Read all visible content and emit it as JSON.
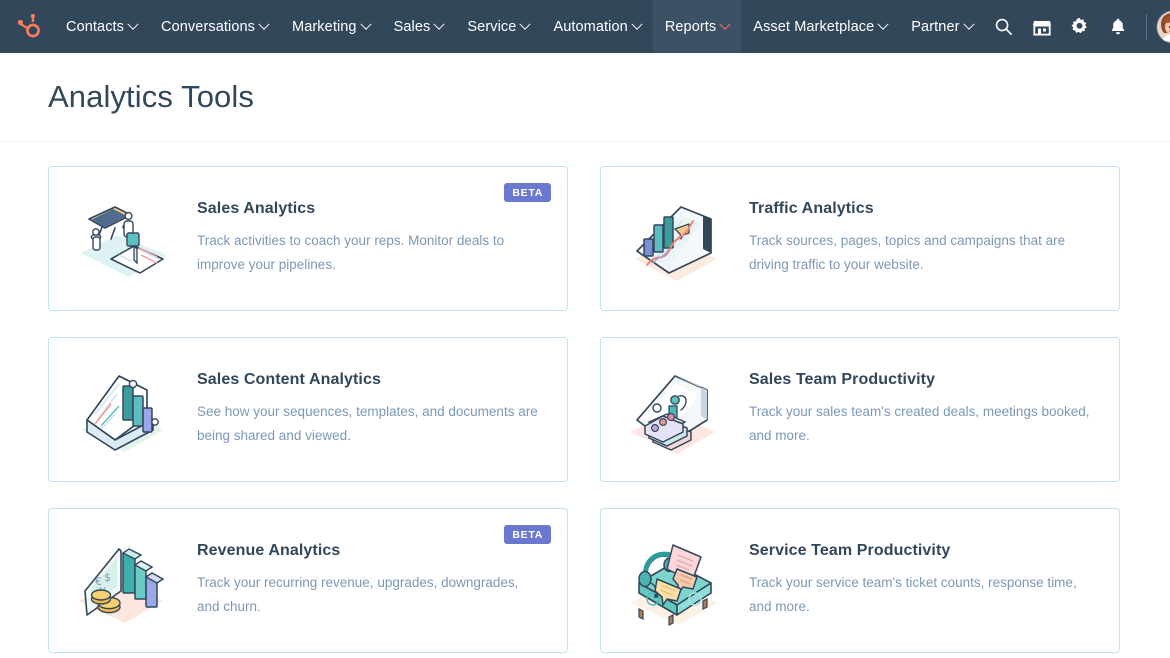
{
  "nav": {
    "logo_icon": "hubspot-sprocket-logo",
    "items": [
      {
        "label": "Contacts",
        "icon": "chevron-down-icon",
        "active": false
      },
      {
        "label": "Conversations",
        "icon": "chevron-down-icon",
        "active": false
      },
      {
        "label": "Marketing",
        "icon": "chevron-down-icon",
        "active": false
      },
      {
        "label": "Sales",
        "icon": "chevron-down-icon",
        "active": false
      },
      {
        "label": "Service",
        "icon": "chevron-down-icon",
        "active": false
      },
      {
        "label": "Automation",
        "icon": "chevron-down-icon",
        "active": false
      },
      {
        "label": "Reports",
        "icon": "chevron-down-icon",
        "active": true
      },
      {
        "label": "Asset Marketplace",
        "icon": "chevron-down-icon",
        "active": false
      },
      {
        "label": "Partner",
        "icon": "chevron-down-icon",
        "active": false
      }
    ],
    "actions": [
      {
        "icon": "search-icon"
      },
      {
        "icon": "marketplace-storefront-icon"
      },
      {
        "icon": "gear-icon"
      },
      {
        "icon": "bell-notifications-icon"
      }
    ],
    "avatar_icon": "user-avatar",
    "avatar_chevron_icon": "chevron-down-icon"
  },
  "header": {
    "title": "Analytics Tools"
  },
  "colors": {
    "nav_background": "#33475B",
    "brand_orange": "#FF7A59",
    "card_border": "#BDE5EC",
    "title_text": "#33475B",
    "body_text": "#7C98B6",
    "badge_purple": "#6A78D1"
  },
  "cards": [
    {
      "title": "Sales Analytics",
      "description": "Track activities to coach your reps. Monitor deals to improve your pipelines.",
      "badge": "BETA",
      "illustration": "chalkboard-people-book-illustration"
    },
    {
      "title": "Traffic Analytics",
      "description": "Track sources, pages, topics and campaigns that are driving traffic to your website.",
      "badge": null,
      "illustration": "laptop-bar-chart-illustration"
    },
    {
      "title": "Sales Content Analytics",
      "description": "See how your sequences, templates, and documents are being shared and viewed.",
      "badge": null,
      "illustration": "document-bar-chart-illustration"
    },
    {
      "title": "Sales Team Productivity",
      "description": "Track your sales team's created deals, meetings booked, and more.",
      "badge": null,
      "illustration": "dashboard-cards-illustration"
    },
    {
      "title": "Revenue Analytics",
      "description": "Track your recurring revenue, upgrades, downgrades, and churn.",
      "badge": "BETA",
      "illustration": "currency-coins-bar-chart-illustration"
    },
    {
      "title": "Service Team Productivity",
      "description": "Track your service team's ticket counts, response time, and more.",
      "badge": null,
      "illustration": "headset-support-desk-illustration"
    }
  ]
}
